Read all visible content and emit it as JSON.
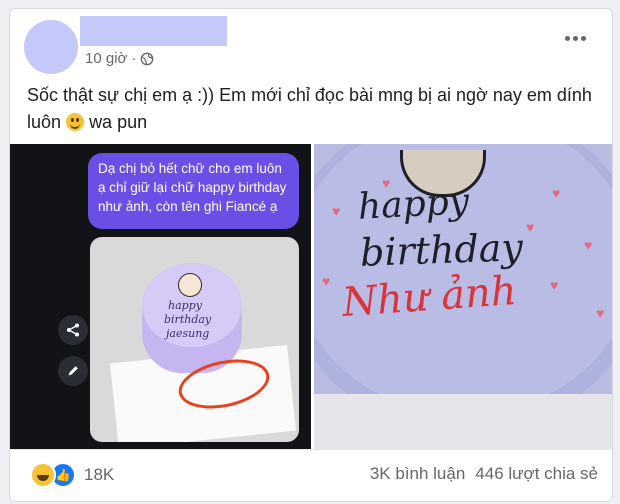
{
  "post": {
    "timestamp": "10 giờ",
    "text": "Sốc thật sự chị em ạ :)) Em mới chỉ đọc bài mng bị ai ngờ nay em dính luôn",
    "text_tail": " wa pun"
  },
  "left_image": {
    "chat_bubble": "Dạ chị bỏ hết chữ cho em luôn ạ chỉ giữ lại chữ happy birthday như ảnh, còn tên ghi Fiancé ạ",
    "cake_lines": [
      "happy",
      "birthday",
      "jaesung"
    ]
  },
  "right_image": {
    "line1": "happy",
    "line2": "birthday",
    "line3": "Như ảnh"
  },
  "footer": {
    "reaction_count": "18K",
    "comments": "3K bình luận",
    "shares": "446 lượt chia sẻ"
  }
}
